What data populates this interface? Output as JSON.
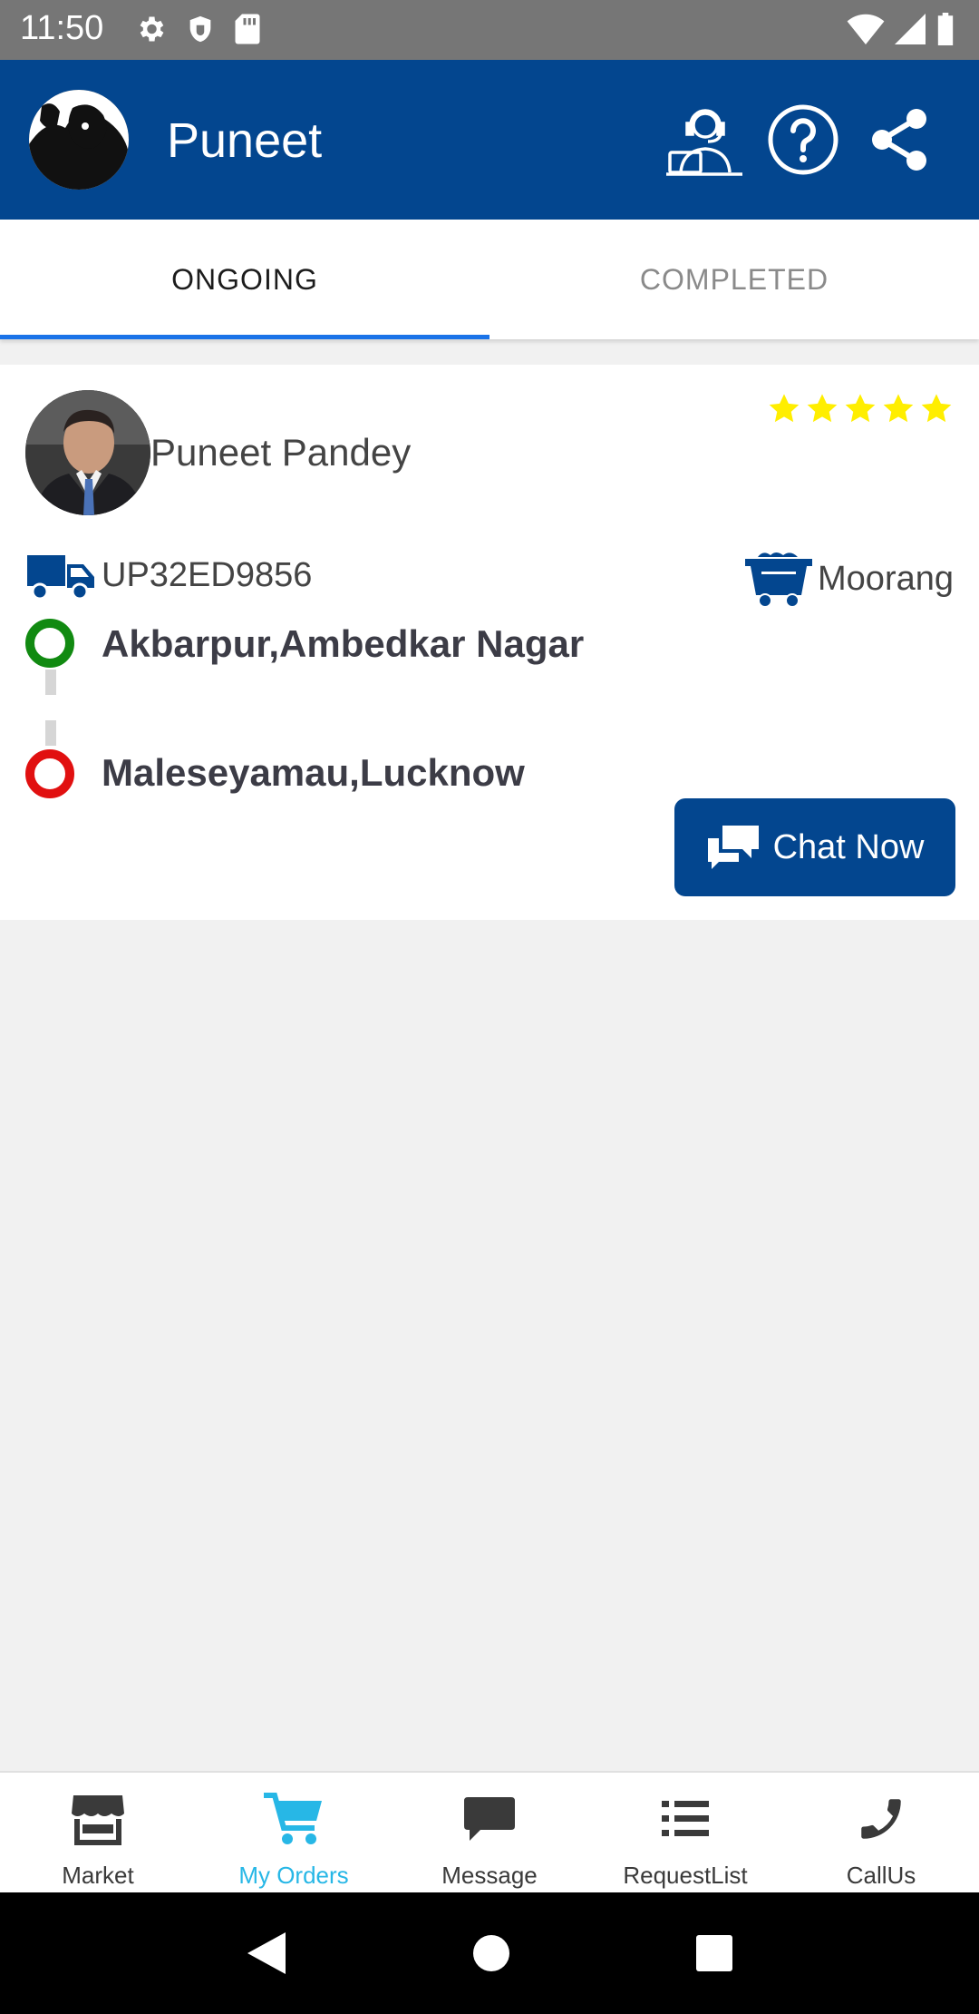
{
  "status_bar": {
    "time": "11:50",
    "left_icons": [
      "gear-icon",
      "shield-icon",
      "sd-card-icon"
    ],
    "right_icons": [
      "wifi-icon",
      "signal-icon",
      "battery-icon"
    ]
  },
  "app_bar": {
    "title": "Puneet",
    "background": "#03468f",
    "actions": [
      "support-agent-icon",
      "help-icon",
      "share-icon"
    ]
  },
  "tabs": [
    {
      "label": "ONGOING",
      "active": true
    },
    {
      "label": "COMPLETED",
      "active": false
    }
  ],
  "order": {
    "driver_name": "Puneet Pandey",
    "rating": 5,
    "vehicle_number": "UP32ED9856",
    "material": "Moorang",
    "from": "Akbarpur,Ambedkar Nagar",
    "to": "Maleseyamau,Lucknow",
    "chat_label": "Chat Now"
  },
  "bottom_nav": [
    {
      "label": "Market",
      "icon": "store-icon",
      "active": false
    },
    {
      "label": "My Orders",
      "icon": "cart-icon",
      "active": true
    },
    {
      "label": "Message",
      "icon": "message-icon",
      "active": false
    },
    {
      "label": "RequestList",
      "icon": "list-icon",
      "active": false
    },
    {
      "label": "CallUs",
      "icon": "phone-icon",
      "active": false
    }
  ],
  "colors": {
    "primary": "#03468f",
    "accent_active_nav": "#27b7e6",
    "tab_indicator": "#1a73e8",
    "star": "#ffee00",
    "from_dot": "#118a11",
    "to_dot": "#e11010"
  }
}
